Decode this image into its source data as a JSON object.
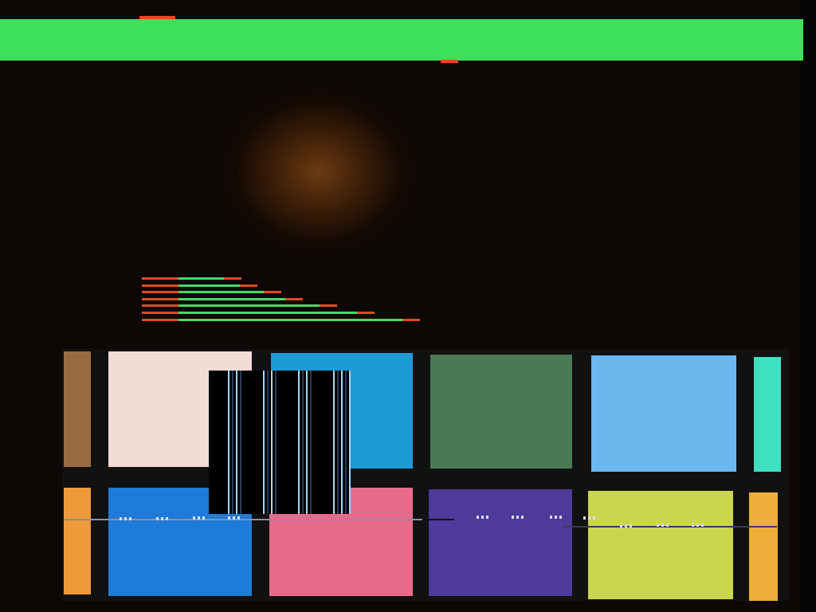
{
  "colors": {
    "green_bar": "#3ee05a",
    "marker_red": "#e04a1e",
    "row_red": "#e04a1e",
    "row_green": "#45d96a",
    "overlay_black": "#000000",
    "stripe_light": "#a8d8f0",
    "stripe_dark": "#2a3a55"
  },
  "progress": {
    "rows": [
      {
        "green_fraction": 0.17,
        "end_fraction": 0.055
      },
      {
        "green_fraction": 0.23,
        "end_fraction": 0.055
      },
      {
        "green_fraction": 0.32,
        "end_fraction": 0.055
      },
      {
        "green_fraction": 0.4,
        "end_fraction": 0.055
      },
      {
        "green_fraction": 0.53,
        "end_fraction": 0.055
      },
      {
        "green_fraction": 0.67,
        "end_fraction": 0.055
      },
      {
        "green_fraction": 0.84,
        "end_fraction": 0.055
      }
    ]
  },
  "tiles_top": [
    {
      "name": "tile-brown",
      "color": "#9a6b43"
    },
    {
      "name": "tile-pale-pink",
      "color": "#f2dcd6"
    },
    {
      "name": "tile-sky-blue",
      "color": "#1e9ad6"
    },
    {
      "name": "tile-forest-green",
      "color": "#4a7a55"
    },
    {
      "name": "tile-light-blue",
      "color": "#6bb7ee"
    },
    {
      "name": "tile-aqua",
      "color": "#3fe0c0"
    }
  ],
  "tiles_bottom": [
    {
      "name": "tile-orange",
      "color": "#ee9a3a"
    },
    {
      "name": "tile-blue",
      "color": "#1f7bd9"
    },
    {
      "name": "tile-pink",
      "color": "#ea6a8c"
    },
    {
      "name": "tile-violet",
      "color": "#4e3a9a"
    },
    {
      "name": "tile-yellow-green",
      "color": "#c9d64e"
    },
    {
      "name": "tile-amber",
      "color": "#eeae3a"
    }
  ]
}
